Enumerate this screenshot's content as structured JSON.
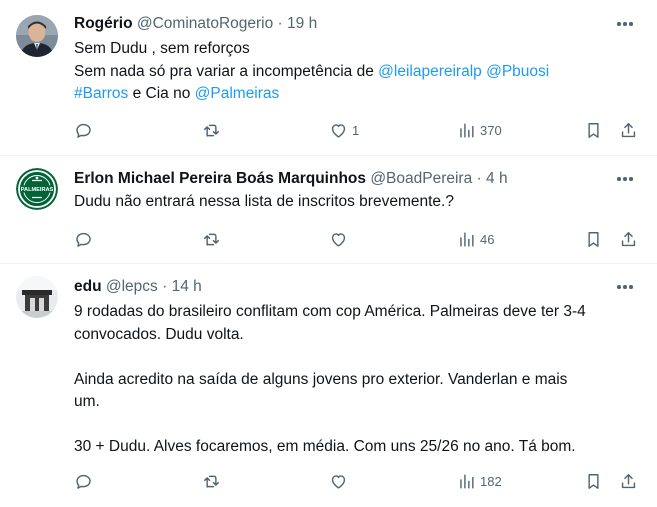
{
  "tweets": [
    {
      "author": "Rogério",
      "handle": "@CominatoRogerio",
      "separator": "·",
      "time": "19 h",
      "lines": [
        [
          {
            "t": "Sem Dudu , sem reforços"
          }
        ],
        [
          {
            "t": "Sem nada só pra variar a incompetência de "
          },
          {
            "t": "@leilapereiralp",
            "m": true
          },
          {
            "t": " "
          },
          {
            "t": "@Pbuosi",
            "m": true
          }
        ],
        [
          {
            "t": "#Barros",
            "m": true
          },
          {
            "t": " e Cia no "
          },
          {
            "t": "@Palmeiras",
            "m": true
          }
        ]
      ],
      "replies": "",
      "retweets": "",
      "likes": "1",
      "views": "370"
    },
    {
      "author": "Erlon Michael Pereira Boás Marquinhos",
      "handle": "@BoadPereira",
      "separator": "·",
      "time": "4 h",
      "lines": [
        [
          {
            "t": "Dudu não entrará nessa lista de inscritos brevemente.?"
          }
        ]
      ],
      "replies": "",
      "retweets": "",
      "likes": "",
      "views": "46"
    },
    {
      "author": "edu",
      "handle": "@lepcs",
      "separator": "·",
      "time": "14 h",
      "lines": [
        [
          {
            "t": "9 rodadas do brasileiro conflitam com cop América. Palmeiras deve ter 3-4"
          }
        ],
        [
          {
            "t": "convocados.  Dudu volta."
          }
        ],
        [],
        [
          {
            "t": "Ainda acredito na saída de alguns jovens pro exterior. Vanderlan e mais"
          }
        ],
        [
          {
            "t": "um."
          }
        ],
        [],
        [
          {
            "t": "30 + Dudu. Alves focaremos, em média. Com uns 25/26 no ano. Tá bom."
          }
        ]
      ],
      "replies": "",
      "retweets": "",
      "likes": "",
      "views": "182"
    }
  ],
  "avatar_text": {
    "palmeiras_logo": "PALMEIRAS"
  },
  "icons": [
    "more-icon",
    "reply-icon",
    "retweet-icon",
    "like-icon",
    "views-icon",
    "bookmark-icon",
    "share-icon"
  ],
  "colors": {
    "mention": "#1d9bf0",
    "muted": "#536471",
    "text": "#0f1419",
    "divider": "#eff3f4",
    "palmeiras_green": "#006437"
  }
}
